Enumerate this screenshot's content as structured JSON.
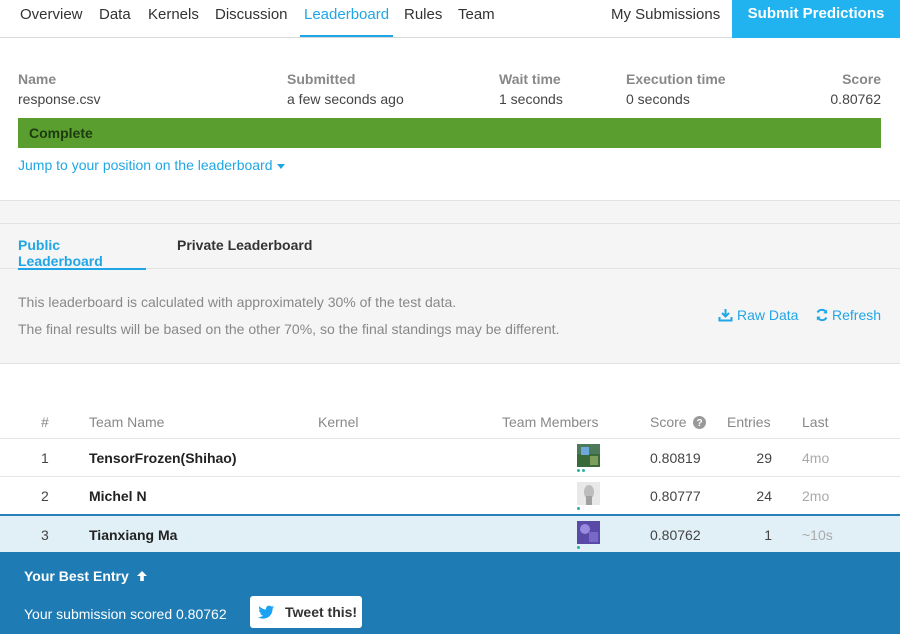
{
  "nav": {
    "tabs": [
      "Overview",
      "Data",
      "Kernels",
      "Discussion",
      "Leaderboard",
      "Rules",
      "Team"
    ],
    "active_tab": "Leaderboard",
    "my_submissions": "My Submissions",
    "submit_predictions": "Submit Predictions"
  },
  "submission": {
    "headers": {
      "name": "Name",
      "submitted": "Submitted",
      "wait": "Wait time",
      "execution": "Execution time",
      "score": "Score"
    },
    "name": "response.csv",
    "submitted": "a few seconds ago",
    "wait": "1 seconds",
    "execution": "0 seconds",
    "score": "0.80762",
    "status": "Complete",
    "status_color": "#5a9e2f",
    "jump_link": "Jump to your position on the leaderboard"
  },
  "leaderboard": {
    "tabs": [
      "Public Leaderboard",
      "Private Leaderboard"
    ],
    "note_line1": "This leaderboard is calculated with approximately 30% of the test data.",
    "note_line2": "The final results will be based on the other 70%, so the final standings may be different.",
    "raw_data": "Raw Data",
    "refresh": "Refresh",
    "columns": {
      "rank": "#",
      "team_name": "Team Name",
      "kernel": "Kernel",
      "members": "Team Members",
      "score": "Score",
      "entries": "Entries",
      "last": "Last"
    },
    "rows": [
      {
        "rank": "1",
        "team": "TensorFrozen(Shihao)",
        "score": "0.80819",
        "entries": "29",
        "last": "4mo"
      },
      {
        "rank": "2",
        "team": "Michel N",
        "score": "0.80777",
        "entries": "24",
        "last": "2mo"
      },
      {
        "rank": "3",
        "team": "Tianxiang Ma",
        "score": "0.80762",
        "entries": "1",
        "last": "~10s"
      }
    ]
  },
  "best_entry": {
    "title": "Your Best Entry",
    "scored": "Your submission scored 0.80762",
    "tweet": "Tweet this!"
  },
  "colors": {
    "accent": "#20a6e6",
    "submit_bg": "#20b3f0",
    "best_bg": "#1f7bb3",
    "twitter": "#1da1f2"
  }
}
